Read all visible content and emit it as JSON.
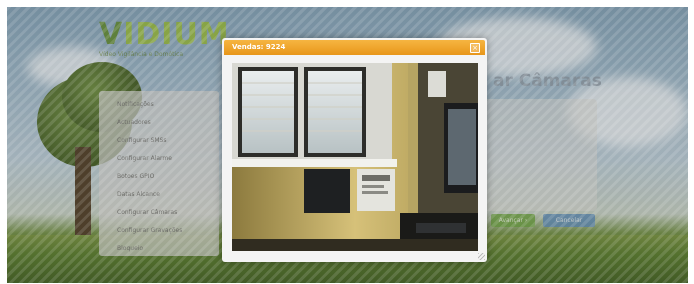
{
  "logo": {
    "text_v": "V",
    "text_rest": "IDIUM",
    "tagline": "Vídeo Vigilância e Domótica"
  },
  "page_title": "ar Câmaras",
  "menu": {
    "items": [
      "Notificações",
      "Actuadores",
      "Configurar SMSs",
      "Configurar Alarme",
      "Botoes GPIO",
      "Datas Alcance",
      "Configurar Câmaras",
      "Configurar Gravações",
      "Bloqueio"
    ]
  },
  "buttons": {
    "next": "Avançar ›",
    "cancel": "Cancelar"
  },
  "modal": {
    "title": "Vendas: 9224",
    "close_label": "×"
  }
}
